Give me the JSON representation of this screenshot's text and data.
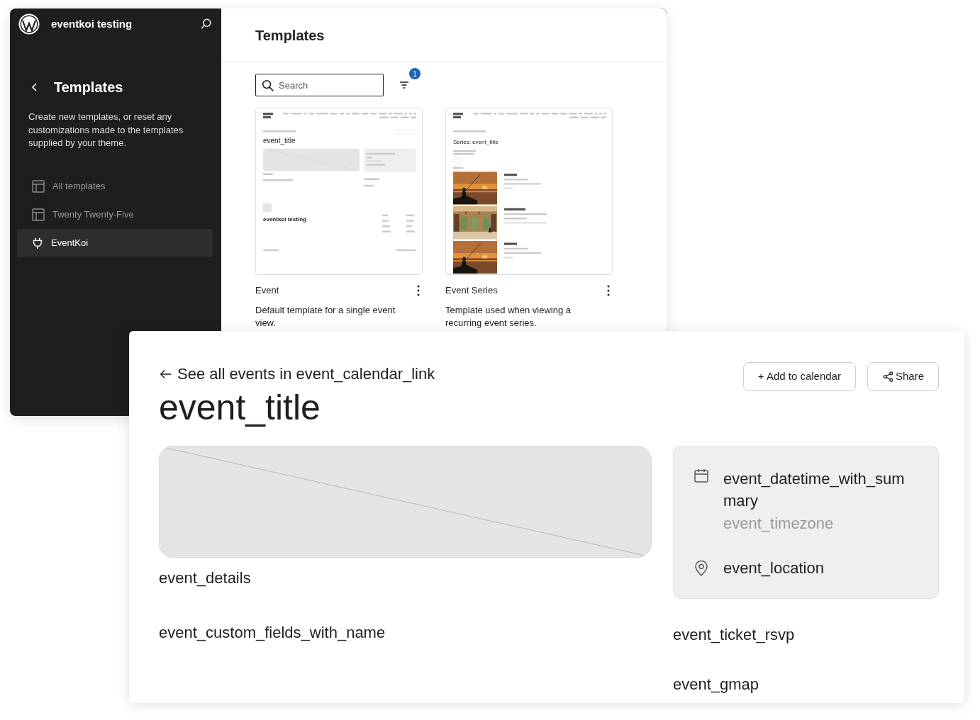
{
  "admin": {
    "site_title": "eventkoi testing",
    "sidebar": {
      "title": "Templates",
      "description": "Create new templates, or reset any customizations made to the templates supplied by your theme.",
      "items": [
        {
          "kind": "layout",
          "label": "All templates",
          "selected": false
        },
        {
          "kind": "layout",
          "label": "Twenty Twenty-Five",
          "selected": false
        },
        {
          "kind": "plugin",
          "label": "EventKoi",
          "selected": true
        }
      ]
    },
    "main": {
      "title": "Templates",
      "search": {
        "placeholder": "Search"
      },
      "filter_count": "1",
      "templates": [
        {
          "kind": "single",
          "name": "Event",
          "description": "Default template for a single event view.",
          "preview": {
            "title": "event_title",
            "footer_site_name": "eventkoi testing"
          }
        },
        {
          "kind": "series",
          "name": "Event Series",
          "description": "Template used when viewing a recurring event series.",
          "preview": {
            "title": "Series: event_title"
          }
        }
      ]
    }
  },
  "event_page": {
    "back_link": "See all events in event_calendar_link",
    "title": "event_title",
    "buttons": [
      {
        "kind": "calendar",
        "label": "+ Add to calendar"
      },
      {
        "kind": "share",
        "label": "Share"
      }
    ],
    "details": "event_details",
    "custom_fields": "event_custom_fields_with_name",
    "datetime": "event_datetime_with_summary",
    "timezone": "event_timezone",
    "location": "event_location",
    "ticket": "event_ticket_rsvp",
    "gmap": "event_gmap"
  }
}
